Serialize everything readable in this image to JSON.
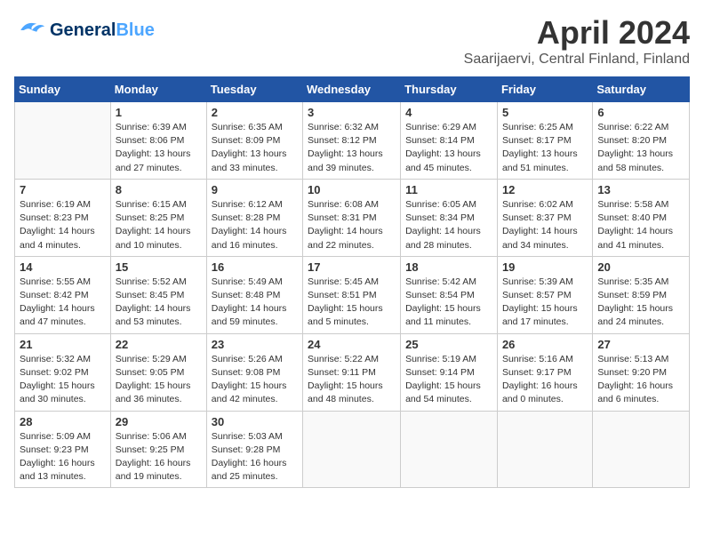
{
  "header": {
    "logo_general": "General",
    "logo_blue": "Blue",
    "title": "April 2024",
    "subtitle": "Saarijaervi, Central Finland, Finland"
  },
  "days_of_week": [
    "Sunday",
    "Monday",
    "Tuesday",
    "Wednesday",
    "Thursday",
    "Friday",
    "Saturday"
  ],
  "weeks": [
    [
      {
        "day": "",
        "info": ""
      },
      {
        "day": "1",
        "info": "Sunrise: 6:39 AM\nSunset: 8:06 PM\nDaylight: 13 hours\nand 27 minutes."
      },
      {
        "day": "2",
        "info": "Sunrise: 6:35 AM\nSunset: 8:09 PM\nDaylight: 13 hours\nand 33 minutes."
      },
      {
        "day": "3",
        "info": "Sunrise: 6:32 AM\nSunset: 8:12 PM\nDaylight: 13 hours\nand 39 minutes."
      },
      {
        "day": "4",
        "info": "Sunrise: 6:29 AM\nSunset: 8:14 PM\nDaylight: 13 hours\nand 45 minutes."
      },
      {
        "day": "5",
        "info": "Sunrise: 6:25 AM\nSunset: 8:17 PM\nDaylight: 13 hours\nand 51 minutes."
      },
      {
        "day": "6",
        "info": "Sunrise: 6:22 AM\nSunset: 8:20 PM\nDaylight: 13 hours\nand 58 minutes."
      }
    ],
    [
      {
        "day": "7",
        "info": "Sunrise: 6:19 AM\nSunset: 8:23 PM\nDaylight: 14 hours\nand 4 minutes."
      },
      {
        "day": "8",
        "info": "Sunrise: 6:15 AM\nSunset: 8:25 PM\nDaylight: 14 hours\nand 10 minutes."
      },
      {
        "day": "9",
        "info": "Sunrise: 6:12 AM\nSunset: 8:28 PM\nDaylight: 14 hours\nand 16 minutes."
      },
      {
        "day": "10",
        "info": "Sunrise: 6:08 AM\nSunset: 8:31 PM\nDaylight: 14 hours\nand 22 minutes."
      },
      {
        "day": "11",
        "info": "Sunrise: 6:05 AM\nSunset: 8:34 PM\nDaylight: 14 hours\nand 28 minutes."
      },
      {
        "day": "12",
        "info": "Sunrise: 6:02 AM\nSunset: 8:37 PM\nDaylight: 14 hours\nand 34 minutes."
      },
      {
        "day": "13",
        "info": "Sunrise: 5:58 AM\nSunset: 8:40 PM\nDaylight: 14 hours\nand 41 minutes."
      }
    ],
    [
      {
        "day": "14",
        "info": "Sunrise: 5:55 AM\nSunset: 8:42 PM\nDaylight: 14 hours\nand 47 minutes."
      },
      {
        "day": "15",
        "info": "Sunrise: 5:52 AM\nSunset: 8:45 PM\nDaylight: 14 hours\nand 53 minutes."
      },
      {
        "day": "16",
        "info": "Sunrise: 5:49 AM\nSunset: 8:48 PM\nDaylight: 14 hours\nand 59 minutes."
      },
      {
        "day": "17",
        "info": "Sunrise: 5:45 AM\nSunset: 8:51 PM\nDaylight: 15 hours\nand 5 minutes."
      },
      {
        "day": "18",
        "info": "Sunrise: 5:42 AM\nSunset: 8:54 PM\nDaylight: 15 hours\nand 11 minutes."
      },
      {
        "day": "19",
        "info": "Sunrise: 5:39 AM\nSunset: 8:57 PM\nDaylight: 15 hours\nand 17 minutes."
      },
      {
        "day": "20",
        "info": "Sunrise: 5:35 AM\nSunset: 8:59 PM\nDaylight: 15 hours\nand 24 minutes."
      }
    ],
    [
      {
        "day": "21",
        "info": "Sunrise: 5:32 AM\nSunset: 9:02 PM\nDaylight: 15 hours\nand 30 minutes."
      },
      {
        "day": "22",
        "info": "Sunrise: 5:29 AM\nSunset: 9:05 PM\nDaylight: 15 hours\nand 36 minutes."
      },
      {
        "day": "23",
        "info": "Sunrise: 5:26 AM\nSunset: 9:08 PM\nDaylight: 15 hours\nand 42 minutes."
      },
      {
        "day": "24",
        "info": "Sunrise: 5:22 AM\nSunset: 9:11 PM\nDaylight: 15 hours\nand 48 minutes."
      },
      {
        "day": "25",
        "info": "Sunrise: 5:19 AM\nSunset: 9:14 PM\nDaylight: 15 hours\nand 54 minutes."
      },
      {
        "day": "26",
        "info": "Sunrise: 5:16 AM\nSunset: 9:17 PM\nDaylight: 16 hours\nand 0 minutes."
      },
      {
        "day": "27",
        "info": "Sunrise: 5:13 AM\nSunset: 9:20 PM\nDaylight: 16 hours\nand 6 minutes."
      }
    ],
    [
      {
        "day": "28",
        "info": "Sunrise: 5:09 AM\nSunset: 9:23 PM\nDaylight: 16 hours\nand 13 minutes."
      },
      {
        "day": "29",
        "info": "Sunrise: 5:06 AM\nSunset: 9:25 PM\nDaylight: 16 hours\nand 19 minutes."
      },
      {
        "day": "30",
        "info": "Sunrise: 5:03 AM\nSunset: 9:28 PM\nDaylight: 16 hours\nand 25 minutes."
      },
      {
        "day": "",
        "info": ""
      },
      {
        "day": "",
        "info": ""
      },
      {
        "day": "",
        "info": ""
      },
      {
        "day": "",
        "info": ""
      }
    ]
  ]
}
